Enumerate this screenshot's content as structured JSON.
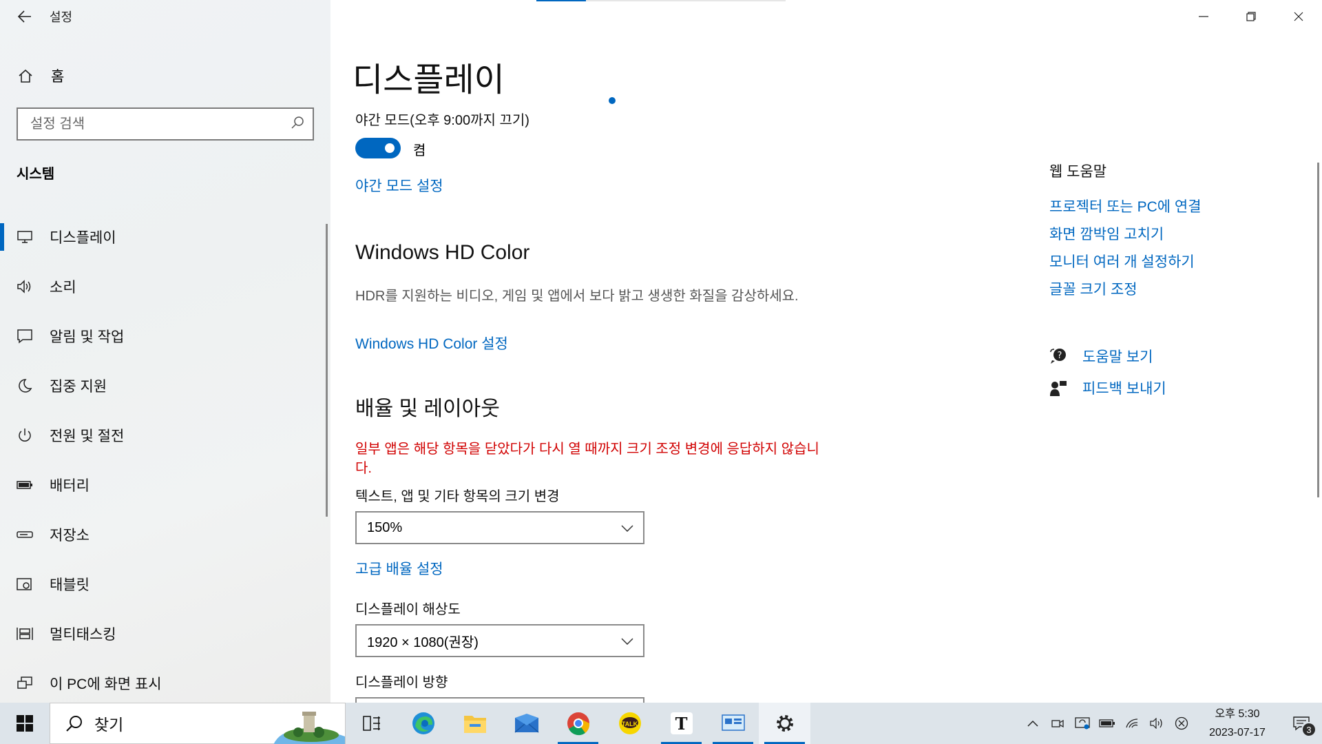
{
  "window": {
    "title": "설정"
  },
  "sidebar": {
    "home_label": "홈",
    "search_placeholder": "설정 검색",
    "section_title": "시스템",
    "items": [
      {
        "label": "디스플레이",
        "icon": "monitor-icon",
        "active": true
      },
      {
        "label": "소리",
        "icon": "speaker-icon"
      },
      {
        "label": "알림 및 작업",
        "icon": "message-icon"
      },
      {
        "label": "집중 지원",
        "icon": "moon-icon"
      },
      {
        "label": "전원 및 절전",
        "icon": "power-icon"
      },
      {
        "label": "배터리",
        "icon": "battery-icon"
      },
      {
        "label": "저장소",
        "icon": "storage-icon"
      },
      {
        "label": "태블릿",
        "icon": "tablet-icon"
      },
      {
        "label": "멀티태스킹",
        "icon": "multitasking-icon"
      },
      {
        "label": "이 PC에 화면 표시",
        "icon": "project-icon"
      }
    ]
  },
  "main": {
    "page_title": "디스플레이",
    "night_mode": {
      "label": "야간 모드(오후 9:00까지 끄기)",
      "toggle_state": "켬",
      "toggle_on": true,
      "settings_link": "야간 모드 설정"
    },
    "hdr": {
      "heading": "Windows HD Color",
      "description": "HDR를 지원하는 비디오, 게임 및 앱에서 보다 밝고 생생한 화질을 감상하세요.",
      "link": "Windows HD Color 설정"
    },
    "scale_layout": {
      "heading": "배율 및 레이아웃",
      "warning": "일부 앱은 해당 항목을 닫았다가 다시 열 때까지 크기 조정 변경에 응답하지 않습니다.",
      "scale_label": "텍스트, 앱 및 기타 항목의 크기 변경",
      "scale_value": "150%",
      "advanced_link": "고급 배율 설정",
      "resolution_label": "디스플레이 해상도",
      "resolution_value": "1920 × 1080(권장)",
      "orientation_label": "디스플레이 방향"
    }
  },
  "right_panel": {
    "web_help_title": "웹 도움말",
    "links": [
      "프로젝터 또는 PC에 연결",
      "화면 깜박임 고치기",
      "모니터 여러 개 설정하기",
      "글꼴 크기 조정"
    ],
    "get_help": "도움말 보기",
    "feedback": "피드백 보내기"
  },
  "taskbar": {
    "search_label": "찾기",
    "apps": [
      "task-view-icon",
      "edge-icon",
      "file-explorer-icon",
      "mail-icon",
      "chrome-icon",
      "kakaotalk-icon",
      "typora-icon",
      "remote-desktop-icon",
      "settings-icon"
    ],
    "kakao_label": "TALK",
    "typora_label": "T",
    "clock_time": "오후 5:30",
    "clock_date": "2023-07-17",
    "notification_count": "3"
  },
  "colors": {
    "accent": "#0067c0",
    "warning": "#d10000",
    "taskbar": "#dde4ea"
  }
}
